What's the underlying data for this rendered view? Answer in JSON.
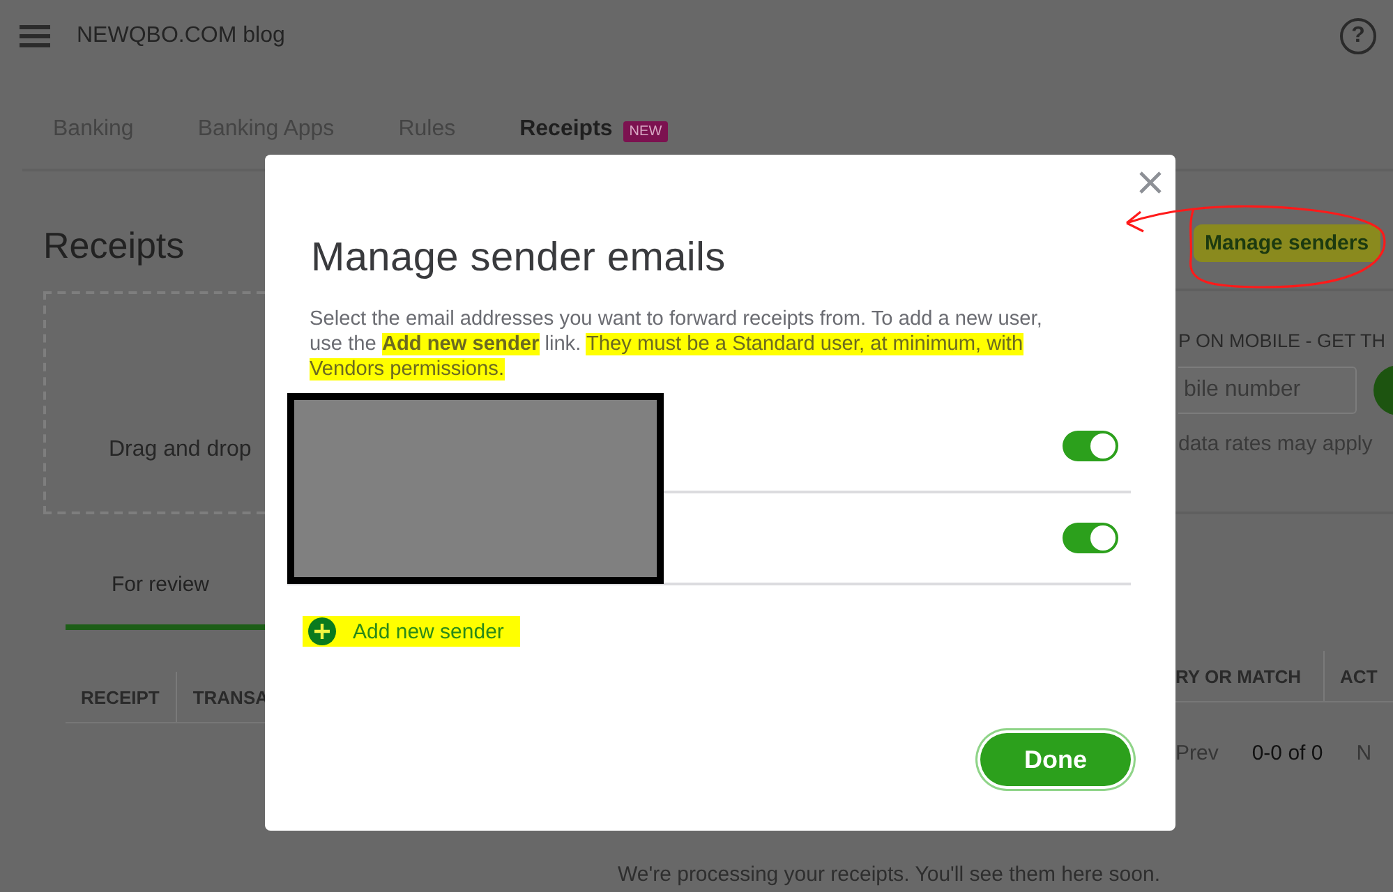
{
  "app": {
    "title": "NEWQBO.COM blog",
    "help": "?"
  },
  "tabs": [
    {
      "label": "Banking",
      "selected": false
    },
    {
      "label": "Banking Apps",
      "selected": false
    },
    {
      "label": "Rules",
      "selected": false
    },
    {
      "label": "Receipts",
      "selected": true,
      "badge": "NEW"
    }
  ],
  "page": {
    "title": "Receipts",
    "dropzone": "Drag and drop",
    "manage_link": {
      "label": "Manage senders",
      "highlighted": true
    },
    "mobile": {
      "heading": "P ON MOBILE - GET TH",
      "placeholder": "bile number",
      "note": "data rates may apply"
    }
  },
  "review_tabs": [
    {
      "label": "For review",
      "selected": true
    }
  ],
  "table": {
    "columns_left": [
      "RECEIPT",
      "TRANSA"
    ],
    "columns_right": [
      "RY OR MATCH",
      "ACT"
    ]
  },
  "pagination": [
    {
      "label": "Prev",
      "disabled": true
    },
    {
      "label": "0-0 of 0",
      "disabled": false
    },
    {
      "label": "N",
      "disabled": true
    }
  ],
  "empty_message": "We're processing your receipts. You'll see them here soon.",
  "dialog": {
    "title": "Manage sender emails",
    "description": [
      {
        "text": "Select the email addresses you want to forward receipts from. To add a new user, use the ",
        "highlighted": false
      },
      {
        "text": "**Add new sender**",
        "highlighted": true
      },
      {
        "text": " link. ",
        "highlighted": false
      },
      {
        "text": "They must be a Standard user, at minimum, with Vendors permissions.",
        "highlighted": true
      }
    ],
    "senders": [
      {
        "on": true
      },
      {
        "on": true
      }
    ],
    "add_link": {
      "label": "Add new sender",
      "highlighted": true
    },
    "done_button": "Done"
  }
}
